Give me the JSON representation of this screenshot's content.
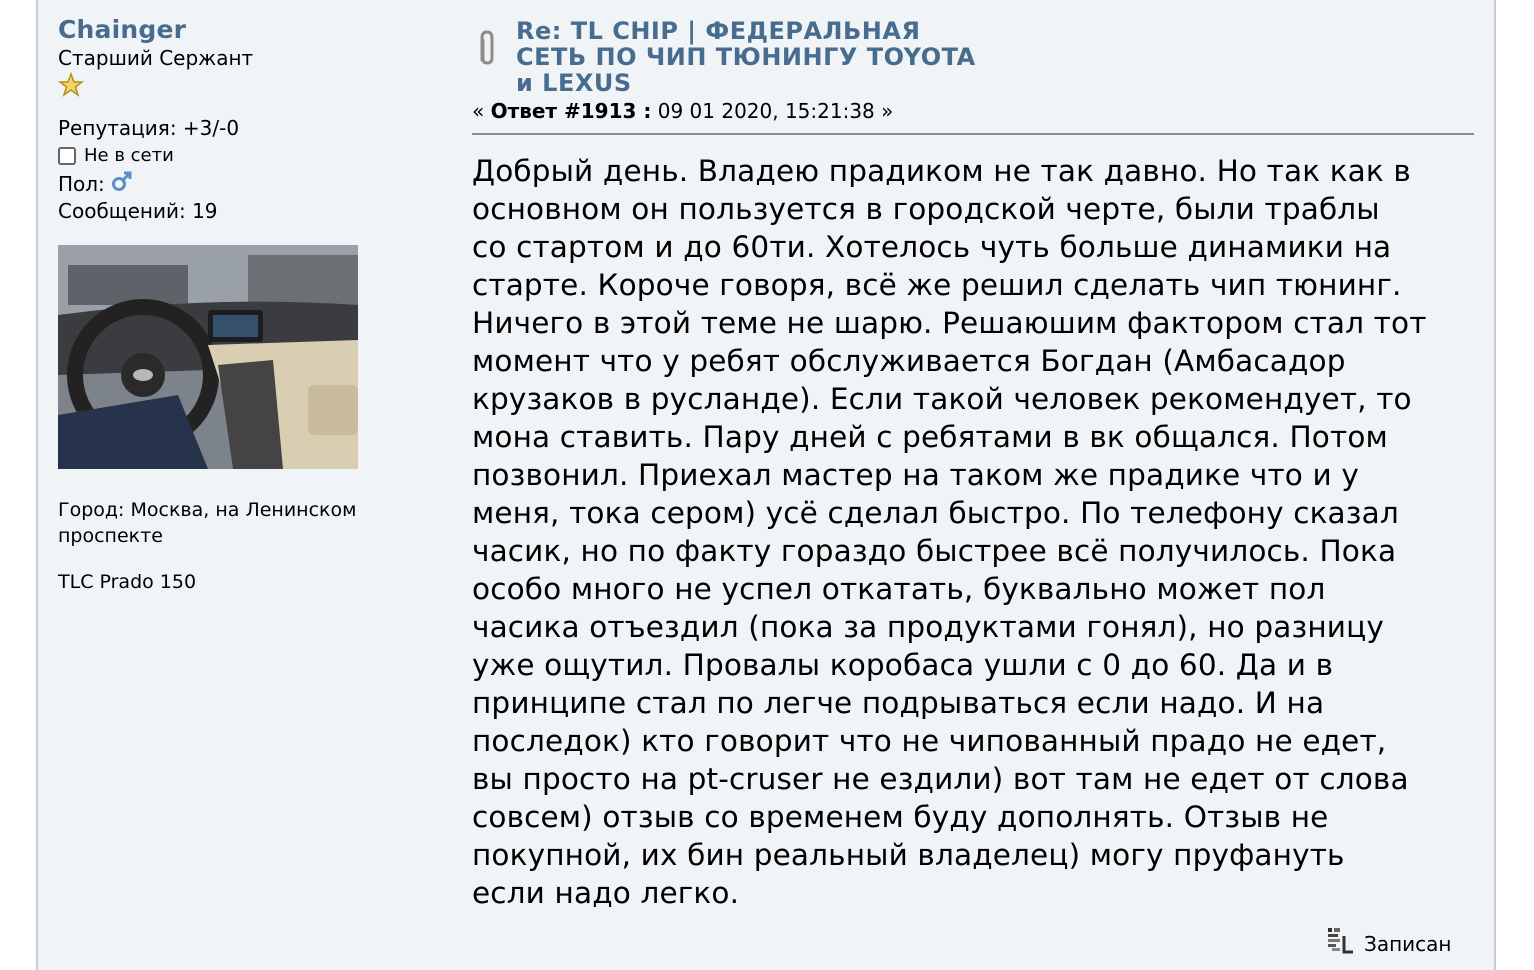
{
  "poster": {
    "name": "Chainger",
    "rank": "Старший Сержант",
    "reputation": "Репутация: +3/-0",
    "online_status": "Не в сети",
    "gender_label": "Пол:",
    "posts_count": "Сообщений: 19",
    "city": "Город: Москва, на Ленинском проспекте",
    "car": "TLC Prado 150",
    "icons": {
      "rank": "star-icon",
      "online": "offline-icon",
      "gender": "male-icon"
    }
  },
  "post": {
    "subject": "Re: TL CHIP | ФЕДЕРАЛЬНАЯ СЕТЬ ПО ЧИП ТЮНИНГУ TOYOTA и LEXUS",
    "reply_prefix": "«",
    "reply_label": "Ответ #1913 :",
    "reply_datetime": "09 01 2020, 15:21:38",
    "reply_suffix": "»",
    "body_lines": [
      "Добрый день. Владею прадиком не так давно. Но так как в",
      "основном он пользуется в городской черте, были траблы",
      "со стартом и до 60ти. Хотелось чуть больше динамики на",
      "старте. Короче говоря, всё же решил сделать чип тюнинг.",
      "Ничего в этой теме не шарю. Решаюшим фактором стал тот",
      "момент что у ребят обслуживается Богдан (Амбасадор",
      "крузаков в русланде). Если такой человек рекомендует, то",
      "мона ставить. Пару дней с ребятами в вк общался. Потом",
      "позвонил. Приехал мастер на таком же прадике что и у",
      "меня, тока сером) усё сделал быстро. По телефону сказал",
      "часик, но по факту гораздо быстрее всё получилось. Пока",
      "особо много не успел откатать, буквально может пол",
      "часика отъездил (пока за продуктами гонял), но разницу",
      "уже ощутил. Провалы коробаса ушли с 0 до 60. Да и в",
      "принципе стал по легче подрываться если надо. И на",
      "последок) кто говорит что не чипованный прадо не едет,",
      "вы просто на pt-cruser не ездили) вот там не едет от слова",
      "совсем) отзыв со временем буду дополнять. Отзыв не",
      "покупной, их бин реальный владелец) могу пруфануть",
      "если надо легко."
    ],
    "logged_label": "Записан",
    "icons": {
      "attachment": "paperclip-icon",
      "logged": "ip-logged-icon"
    }
  }
}
